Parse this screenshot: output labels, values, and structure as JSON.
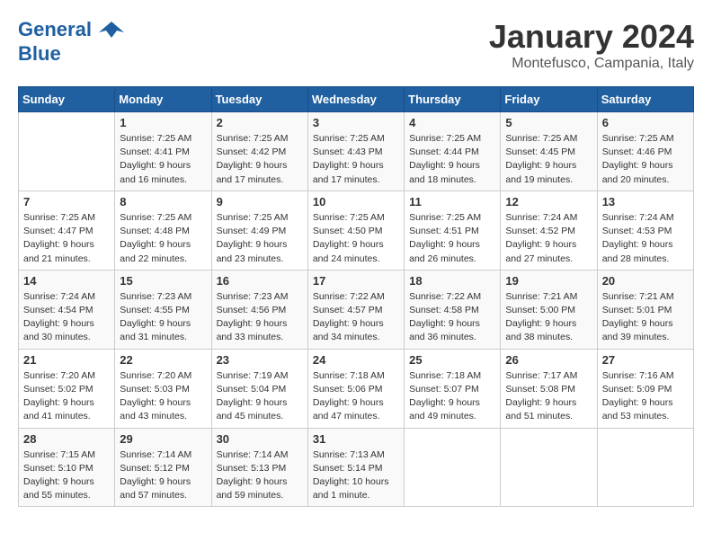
{
  "header": {
    "logo_line1": "General",
    "logo_line2": "Blue",
    "month": "January 2024",
    "location": "Montefusco, Campania, Italy"
  },
  "weekdays": [
    "Sunday",
    "Monday",
    "Tuesday",
    "Wednesday",
    "Thursday",
    "Friday",
    "Saturday"
  ],
  "weeks": [
    [
      {
        "day": "",
        "info": ""
      },
      {
        "day": "1",
        "info": "Sunrise: 7:25 AM\nSunset: 4:41 PM\nDaylight: 9 hours\nand 16 minutes."
      },
      {
        "day": "2",
        "info": "Sunrise: 7:25 AM\nSunset: 4:42 PM\nDaylight: 9 hours\nand 17 minutes."
      },
      {
        "day": "3",
        "info": "Sunrise: 7:25 AM\nSunset: 4:43 PM\nDaylight: 9 hours\nand 17 minutes."
      },
      {
        "day": "4",
        "info": "Sunrise: 7:25 AM\nSunset: 4:44 PM\nDaylight: 9 hours\nand 18 minutes."
      },
      {
        "day": "5",
        "info": "Sunrise: 7:25 AM\nSunset: 4:45 PM\nDaylight: 9 hours\nand 19 minutes."
      },
      {
        "day": "6",
        "info": "Sunrise: 7:25 AM\nSunset: 4:46 PM\nDaylight: 9 hours\nand 20 minutes."
      }
    ],
    [
      {
        "day": "7",
        "info": "Sunrise: 7:25 AM\nSunset: 4:47 PM\nDaylight: 9 hours\nand 21 minutes."
      },
      {
        "day": "8",
        "info": "Sunrise: 7:25 AM\nSunset: 4:48 PM\nDaylight: 9 hours\nand 22 minutes."
      },
      {
        "day": "9",
        "info": "Sunrise: 7:25 AM\nSunset: 4:49 PM\nDaylight: 9 hours\nand 23 minutes."
      },
      {
        "day": "10",
        "info": "Sunrise: 7:25 AM\nSunset: 4:50 PM\nDaylight: 9 hours\nand 24 minutes."
      },
      {
        "day": "11",
        "info": "Sunrise: 7:25 AM\nSunset: 4:51 PM\nDaylight: 9 hours\nand 26 minutes."
      },
      {
        "day": "12",
        "info": "Sunrise: 7:24 AM\nSunset: 4:52 PM\nDaylight: 9 hours\nand 27 minutes."
      },
      {
        "day": "13",
        "info": "Sunrise: 7:24 AM\nSunset: 4:53 PM\nDaylight: 9 hours\nand 28 minutes."
      }
    ],
    [
      {
        "day": "14",
        "info": "Sunrise: 7:24 AM\nSunset: 4:54 PM\nDaylight: 9 hours\nand 30 minutes."
      },
      {
        "day": "15",
        "info": "Sunrise: 7:23 AM\nSunset: 4:55 PM\nDaylight: 9 hours\nand 31 minutes."
      },
      {
        "day": "16",
        "info": "Sunrise: 7:23 AM\nSunset: 4:56 PM\nDaylight: 9 hours\nand 33 minutes."
      },
      {
        "day": "17",
        "info": "Sunrise: 7:22 AM\nSunset: 4:57 PM\nDaylight: 9 hours\nand 34 minutes."
      },
      {
        "day": "18",
        "info": "Sunrise: 7:22 AM\nSunset: 4:58 PM\nDaylight: 9 hours\nand 36 minutes."
      },
      {
        "day": "19",
        "info": "Sunrise: 7:21 AM\nSunset: 5:00 PM\nDaylight: 9 hours\nand 38 minutes."
      },
      {
        "day": "20",
        "info": "Sunrise: 7:21 AM\nSunset: 5:01 PM\nDaylight: 9 hours\nand 39 minutes."
      }
    ],
    [
      {
        "day": "21",
        "info": "Sunrise: 7:20 AM\nSunset: 5:02 PM\nDaylight: 9 hours\nand 41 minutes."
      },
      {
        "day": "22",
        "info": "Sunrise: 7:20 AM\nSunset: 5:03 PM\nDaylight: 9 hours\nand 43 minutes."
      },
      {
        "day": "23",
        "info": "Sunrise: 7:19 AM\nSunset: 5:04 PM\nDaylight: 9 hours\nand 45 minutes."
      },
      {
        "day": "24",
        "info": "Sunrise: 7:18 AM\nSunset: 5:06 PM\nDaylight: 9 hours\nand 47 minutes."
      },
      {
        "day": "25",
        "info": "Sunrise: 7:18 AM\nSunset: 5:07 PM\nDaylight: 9 hours\nand 49 minutes."
      },
      {
        "day": "26",
        "info": "Sunrise: 7:17 AM\nSunset: 5:08 PM\nDaylight: 9 hours\nand 51 minutes."
      },
      {
        "day": "27",
        "info": "Sunrise: 7:16 AM\nSunset: 5:09 PM\nDaylight: 9 hours\nand 53 minutes."
      }
    ],
    [
      {
        "day": "28",
        "info": "Sunrise: 7:15 AM\nSunset: 5:10 PM\nDaylight: 9 hours\nand 55 minutes."
      },
      {
        "day": "29",
        "info": "Sunrise: 7:14 AM\nSunset: 5:12 PM\nDaylight: 9 hours\nand 57 minutes."
      },
      {
        "day": "30",
        "info": "Sunrise: 7:14 AM\nSunset: 5:13 PM\nDaylight: 9 hours\nand 59 minutes."
      },
      {
        "day": "31",
        "info": "Sunrise: 7:13 AM\nSunset: 5:14 PM\nDaylight: 10 hours\nand 1 minute."
      },
      {
        "day": "",
        "info": ""
      },
      {
        "day": "",
        "info": ""
      },
      {
        "day": "",
        "info": ""
      }
    ]
  ]
}
